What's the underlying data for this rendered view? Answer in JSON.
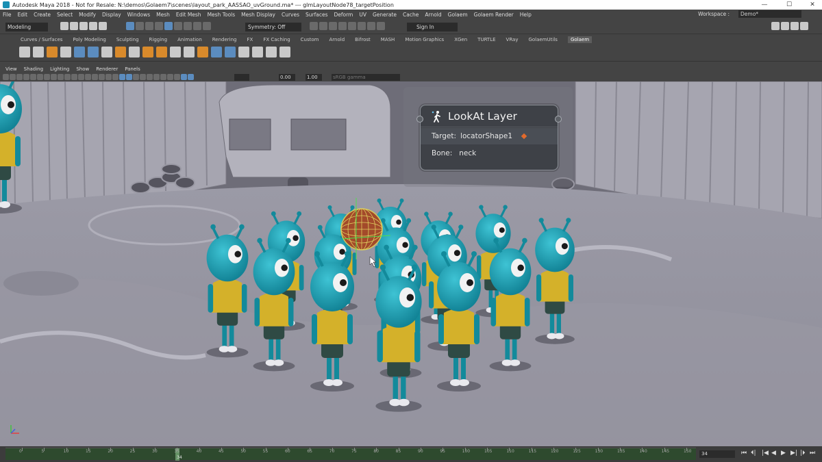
{
  "window": {
    "title": "Autodesk Maya 2018 - Not for Resale: N:\\demos\\Golaem7\\scenes\\layout_park_AASSAO_uvGround.ma*  ---  glmLayoutNode78_targetPosition",
    "controls": [
      "—",
      "☐",
      "✕"
    ]
  },
  "menubar": {
    "items": [
      "File",
      "Edit",
      "Create",
      "Select",
      "Modify",
      "Display",
      "Windows",
      "Mesh",
      "Edit Mesh",
      "Mesh Tools",
      "Mesh Display",
      "Curves",
      "Surfaces",
      "Deform",
      "UV",
      "Generate",
      "Cache",
      "Arnold",
      "Golaem",
      "Golaem Render",
      "Help"
    ],
    "workspace_label": "Workspace :",
    "workspace_value": "Demo*"
  },
  "statusline": {
    "mode": "Modeling",
    "symmetry": "Symmetry: Off",
    "sign_in": "Sign In"
  },
  "shelf": {
    "tabs": [
      "Curves / Surfaces",
      "Poly Modeling",
      "Sculpting",
      "Rigging",
      "Animation",
      "Rendering",
      "FX",
      "FX Caching",
      "Custom",
      "Arnold",
      "Bifrost",
      "MASH",
      "Motion Graphics",
      "XGen",
      "TURTLE",
      "VRay",
      "GolaemUtils",
      "Golaem"
    ],
    "active_tab": "Golaem"
  },
  "panel": {
    "menus": [
      "View",
      "Shading",
      "Lighting",
      "Show",
      "Renderer",
      "Panels"
    ],
    "field1": "0.00",
    "field2": "1.00",
    "colorspace": "sRGB gamma"
  },
  "node": {
    "title": "LookAt Layer",
    "target_label": "Target:",
    "target_value": "locatorShape1",
    "bone_label": "Bone:",
    "bone_value": "neck"
  },
  "timeline": {
    "ticks": [
      "0",
      "5",
      "10",
      "15",
      "20",
      "25",
      "30",
      "35",
      "40",
      "45",
      "50",
      "55",
      "60",
      "65",
      "70",
      "75",
      "80",
      "85",
      "90",
      "95",
      "100",
      "105",
      "110",
      "115",
      "120",
      "125",
      "130",
      "135",
      "140",
      "145",
      "150"
    ],
    "current_frame_marker": "34",
    "current_frame": "34",
    "playback_buttons": [
      "⏮",
      "⏴|",
      "|◀",
      "◀",
      "▶",
      "▶|",
      "|⏵",
      "⏭"
    ]
  }
}
